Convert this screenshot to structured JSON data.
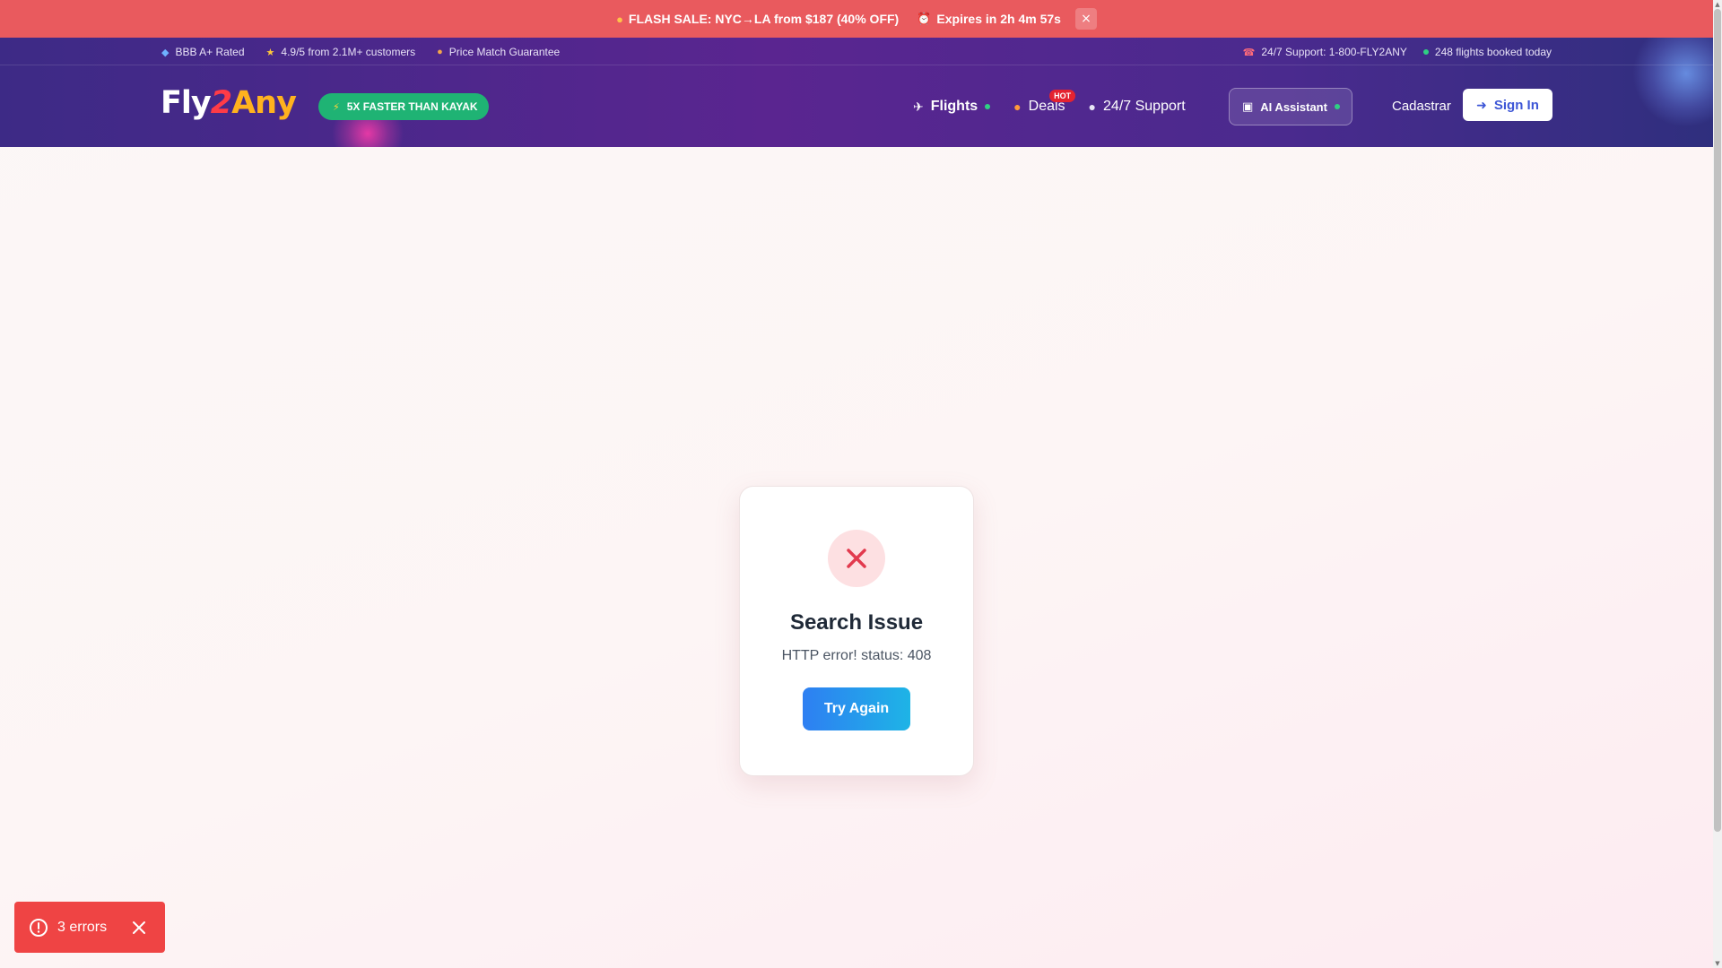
{
  "flash_banner": {
    "sale_text": "FLASH SALE: NYC→LA from $187 (40% OFF)",
    "expires_text": "Expires in 2h 4m 57s",
    "close_label": "×",
    "sale_icon": "flame-icon",
    "timer_icon": "alarm-clock-icon"
  },
  "trust_bar": {
    "left": [
      {
        "icon": "shield-icon",
        "label": "BBB A+ Rated"
      },
      {
        "icon": "star-icon",
        "label": "4.9/5 from 2.1M+ customers"
      },
      {
        "icon": "medal-icon",
        "label": "Price Match Guarantee"
      }
    ],
    "support": "24/7 Support: 1-800-FLY2ANY",
    "bookings": "248 flights booked today"
  },
  "brand": {
    "part1": "Fly",
    "part2": "2",
    "part3": "Any"
  },
  "speed_badge": "5X FASTER THAN KAYAK",
  "nav": {
    "flights": "Flights",
    "deals": "Deals",
    "deals_badge": "HOT",
    "support": "24/7 Support",
    "ai_assistant": "AI Assistant",
    "signup": "Cadastrar",
    "signin": "Sign In"
  },
  "error_card": {
    "title": "Search Issue",
    "message": "HTTP error! status: 408",
    "button": "Try Again"
  },
  "toast": {
    "label": "3 errors"
  },
  "colors": {
    "flash_bg": "#e95a5e",
    "header_gradient_start": "#3d2a86",
    "header_gradient_end": "#2f2f7e",
    "badge_green": "#1fb374",
    "error_red": "#ef4444",
    "button_blue": "#2e7ff2"
  }
}
